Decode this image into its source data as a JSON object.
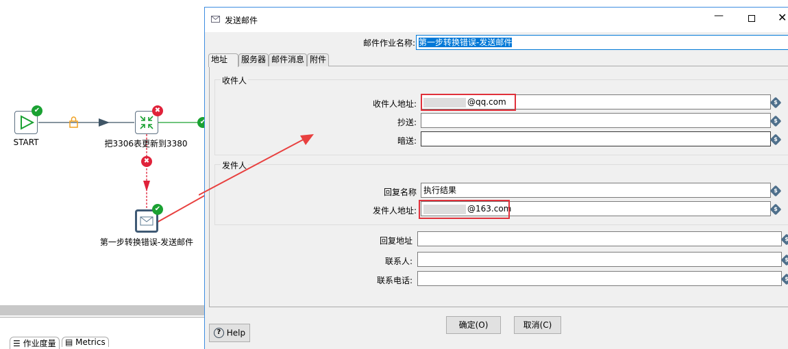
{
  "canvas": {
    "nodes": [
      {
        "label": "START",
        "icon": "play-icon",
        "status": "ok"
      },
      {
        "label": "把3306表更新到3380",
        "icon": "transform-icon",
        "status": "error"
      },
      {
        "label": "第一步转换错误-发送邮件",
        "icon": "mail-icon",
        "status": "ok"
      }
    ],
    "bottom_tabs": [
      "作业度量",
      "Metrics"
    ]
  },
  "dialog": {
    "title": "发送邮件",
    "name_label": "邮件作业名称:",
    "name_value": "第一步转换错误-发送邮件",
    "tabs": [
      "地址",
      "服务器",
      "邮件消息",
      "附件"
    ],
    "recipients": {
      "title": "收件人",
      "to_label": "收件人地址:",
      "to_value": "@qq.com",
      "cc_label": "抄送:",
      "cc_value": "",
      "bcc_label": "暗送:",
      "bcc_value": ""
    },
    "sender": {
      "title": "发件人",
      "reply_name_label": "回复名称",
      "reply_name_value": "执行结果",
      "from_label": "发件人地址:",
      "from_value": "@163.com"
    },
    "reply_address_label": "回复地址",
    "reply_address_value": "",
    "contact_label": "联系人:",
    "contact_value": "",
    "phone_label": "联系电话:",
    "phone_value": "",
    "ok_label": "确定(O)",
    "cancel_label": "取消(C)",
    "help_label": "Help"
  },
  "colors": {
    "accent": "#0078d7",
    "highlight_box": "#e0303a",
    "ok": "#1aa132",
    "error": "#e0223a"
  }
}
